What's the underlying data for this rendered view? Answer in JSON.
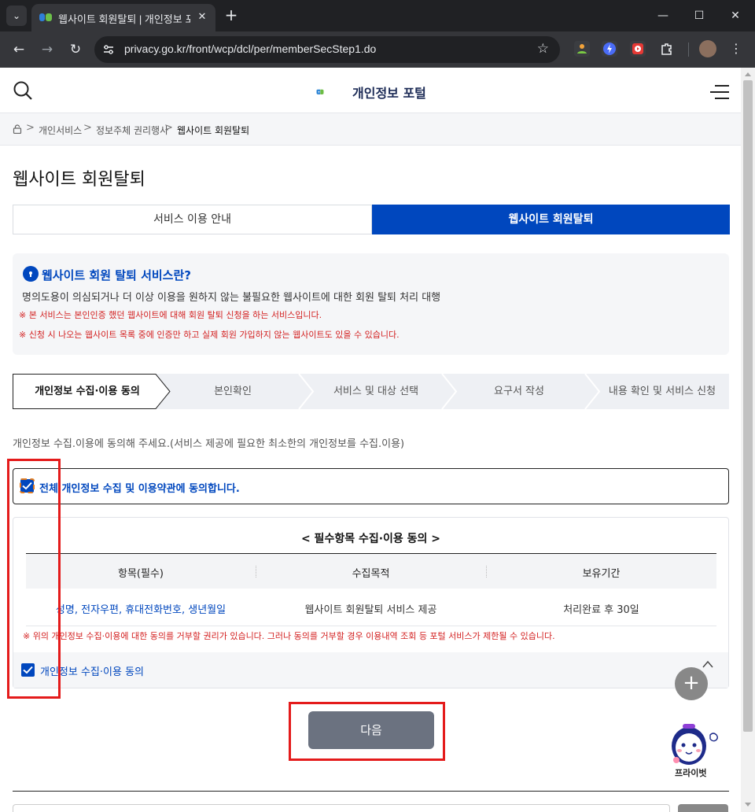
{
  "browser": {
    "tab_title": "웹사이트 회원탈퇴 | 개인정보 포털",
    "tab_close": "✕",
    "new_tab": "+",
    "url": "privacy.go.kr/front/wcp/dcl/per/memberSecStep1.do",
    "minimize": "—",
    "maximize": "☐",
    "close": "✕",
    "back": "←",
    "forward": "→",
    "reload": "↻",
    "bookmark": "☆",
    "menu": "⋮"
  },
  "header": {
    "logo_text": "개인정보 포털"
  },
  "breadcrumb": {
    "items": [
      "개인서비스",
      "정보주체 권리행사",
      "웹사이트 회원탈퇴"
    ],
    "separator": ">"
  },
  "page": {
    "title": "웹사이트 회원탈퇴"
  },
  "tabs": [
    {
      "label": "서비스 이용 안내",
      "active": false
    },
    {
      "label": "웹사이트 회원탈퇴",
      "active": true
    }
  ],
  "info": {
    "title": "웹사이트 회원 탈퇴 서비스란?",
    "description": "명의도용이 의심되거나 더 이상 이용을 원하지 않는 불필요한 웹사이트에 대한 회원 탈퇴 처리 대행",
    "notes": [
      "※ 본 서비스는 본인인증 했던 웹사이트에 대해 회원 탈퇴 신청을 하는 서비스입니다.",
      "※ 신청 시 나오는 웹사이트 목록 중에 인증만 하고 실제 회원 가입하지 않는 웹사이트도 있을 수 있습니다."
    ]
  },
  "steps": [
    {
      "label": "개인정보 수집·이용 동의",
      "active": true
    },
    {
      "label": "본인확인",
      "active": false
    },
    {
      "label": "서비스 및 대상 선택",
      "active": false
    },
    {
      "label": "요구서 작성",
      "active": false
    },
    {
      "label": "내용 확인 및 서비스 신청",
      "active": false
    }
  ],
  "consent": {
    "hint": "개인정보 수집.이용에 동의해 주세요.(서비스 제공에 필요한 최소한의 개인정보를 수집.이용)",
    "all_agree_label": "전체 개인정보 수집 및 이용약관에 동의합니다.",
    "all_agree_checked": true,
    "detail_title": "< 필수항목 수집·이용 동의 >",
    "table": {
      "headers": [
        "항목(필수)",
        "수집목적",
        "보유기간"
      ],
      "rows": [
        [
          "성명, 전자우편, 휴대전화번호, 생년월일",
          "웹사이트 회원탈퇴 서비스 제공",
          "처리완료 후 30일"
        ]
      ]
    },
    "refuse_note": "※ 위의 개인정보 수집·이용에 대한 동의를 거부할 권리가 있습니다. 그러나 동의를 거부할 경우 이용내역 조회 등 포털 서비스가 제한될 수 있습니다.",
    "item_agree_label": "개인정보 수집·이용 동의",
    "item_agree_checked": true
  },
  "actions": {
    "next_label": "다음"
  },
  "floating": {
    "plus": "+",
    "chatbot_label": "프라이벗"
  },
  "colors": {
    "primary": "#0047be",
    "warning": "#d32020",
    "highlight": "#e41b1b"
  }
}
